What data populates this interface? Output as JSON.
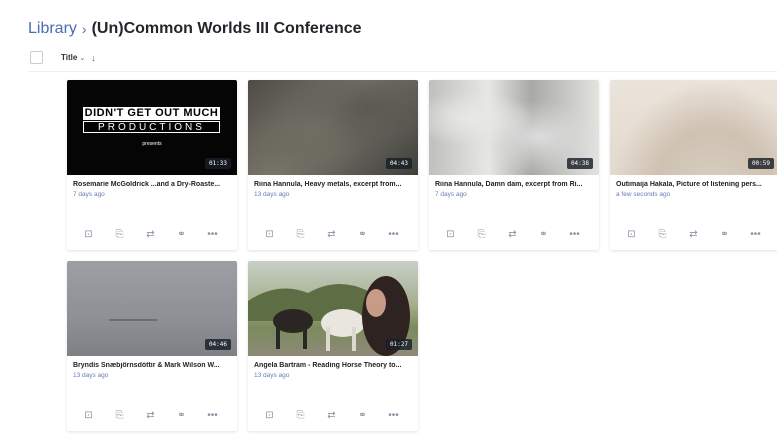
{
  "breadcrumb": {
    "root": "Library",
    "separator": "›",
    "current": "(Un)Common Worlds III Conference"
  },
  "toolbar": {
    "sort_label": "Title",
    "sort_chevron": "⌄",
    "sort_direction_icon": "↓"
  },
  "colors": {
    "link": "#4a6bb5",
    "meta": "#6a7cb0",
    "duration_bg": "#191e28"
  },
  "cards": [
    {
      "title": "Rosemarie McGoldrick ...and a Dry-Roaste...",
      "age": "7 days ago",
      "duration": "01:33",
      "thumb_text": {
        "line1": "DIDN'T GET OUT MUCH",
        "line2": "PRODUCTIONS",
        "line3": "presents"
      }
    },
    {
      "title": "Riina Hannula, Heavy metals, excerpt from...",
      "age": "13 days ago",
      "duration": "04:43"
    },
    {
      "title": "Riina Hannula, Damn dam, excerpt from Ri...",
      "age": "7 days ago",
      "duration": "04:38"
    },
    {
      "title": "Outimaija Hakala, Picture of listening pers...",
      "age": "a few seconds ago",
      "duration": "00:59"
    },
    {
      "title": "Bryndís Snæbjörnsdóttir & Mark Wilson W...",
      "age": "13 days ago",
      "duration": "04:46"
    },
    {
      "title": "Angela Bartram - Reading Horse Theory to...",
      "age": "13 days ago",
      "duration": "01:27"
    }
  ],
  "card_actions": [
    {
      "name": "comment-icon",
      "glyph": "⊡"
    },
    {
      "name": "add-to-playlist-icon",
      "glyph": "⎘"
    },
    {
      "name": "share-icon",
      "glyph": "⇄"
    },
    {
      "name": "link-icon",
      "glyph": "⚭"
    },
    {
      "name": "more-icon",
      "glyph": "•••"
    }
  ]
}
